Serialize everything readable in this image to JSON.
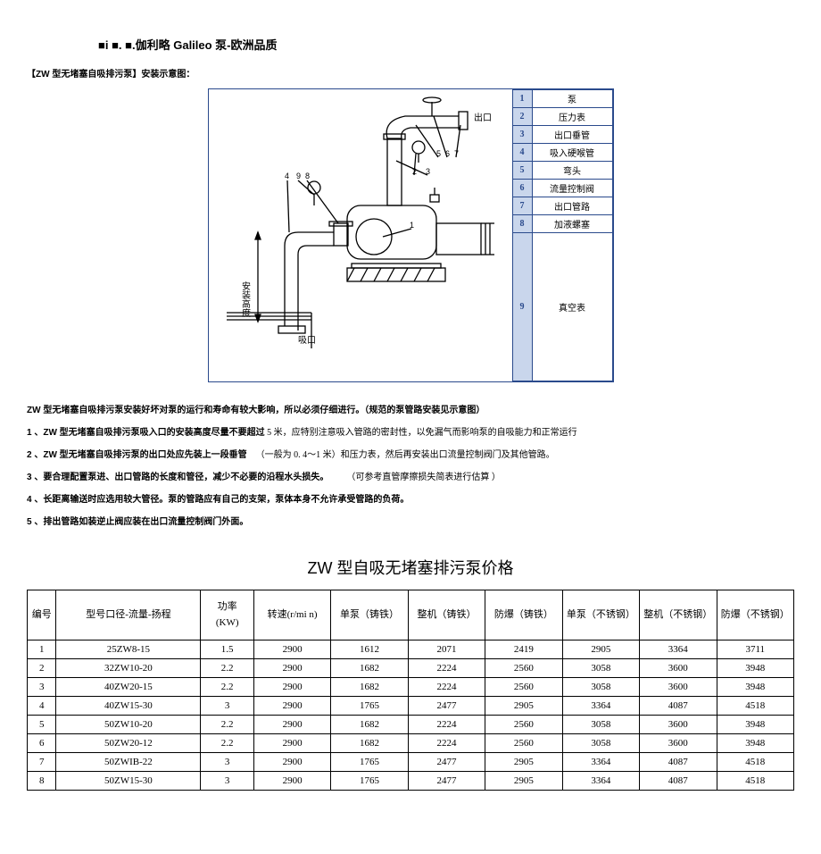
{
  "header": {
    "title": "■i ■. ■.伽利略 Galileo 泵-欧洲品质",
    "subtitle": "【ZW 型无堵塞自吸排污泵】安装示意图："
  },
  "legend": {
    "items": [
      {
        "no": "1",
        "name": "泵"
      },
      {
        "no": "2",
        "name": "压力表"
      },
      {
        "no": "3",
        "name": "出口垂管"
      },
      {
        "no": "4",
        "name": "吸入硬喉管"
      },
      {
        "no": "5",
        "name": "弯头"
      },
      {
        "no": "6",
        "name": "流量控制阀"
      },
      {
        "no": "7",
        "name": "出口管路"
      },
      {
        "no": "8",
        "name": "加液螺塞"
      }
    ],
    "tall": {
      "no": "9",
      "name": "真空表"
    }
  },
  "diagram_labels": {
    "outlet": "出口",
    "install_height": "安装高度",
    "inlet": "吸口"
  },
  "notes": {
    "l0a": "ZW 型无堵塞自吸排污泵安装好坏对泵的运行和寿命有较大影响，所以必须仔细进行。（规范的泵管路安装见示意图）",
    "l1a": "1  、ZW 型无堵塞自吸排污泵吸入口的安装高度尽量不要超过",
    "l1b": "    5 米，应特别注意吸入管路的密封性，以免漏气而影响泵的自吸能力和正常运行",
    "l2a": "2  、ZW 型无堵塞自吸排污泵的出口处应先装上一段垂管",
    "l2b": "（一般为 0. 4～1 米）和压力表，然后再安装出口流量控制阀门及其他管路。",
    "l3a": "3  、要合理配置泵进、出口管路的长度和管径，减少不必要的沿程水头损失。",
    "l3b": "（可参考直管摩擦损失简表进行估算 ）",
    "l4": "4  、长距离输送时应选用较大管径。泵的管路应有自己的支架，泵体本身不允许承受管路的负荷。",
    "l5": "5  、排出管路如装逆止阀应装在出口流量控制阀门外面。"
  },
  "price": {
    "title": "ZW 型自吸无堵塞排污泵价格",
    "headers": {
      "no": "编号",
      "model": "型号口径-流量-扬程",
      "power": "功率\n(KW)",
      "rpm": "转速(r/mi n)",
      "p1": "单泵（铸铁）",
      "p2": "整机（铸铁）",
      "p3": "防爆（铸铁）",
      "p4": "单泵（不锈钢）",
      "p5": "整机（不锈钢）",
      "p6": "防爆（不锈钢）"
    },
    "rows": [
      {
        "no": "1",
        "model": "25ZW8-15",
        "power": "1.5",
        "rpm": "2900",
        "p1": "1612",
        "p2": "2071",
        "p3": "2419",
        "p4": "2905",
        "p5": "3364",
        "p6": "3711"
      },
      {
        "no": "2",
        "model": "32ZW10-20",
        "power": "2.2",
        "rpm": "2900",
        "p1": "1682",
        "p2": "2224",
        "p3": "2560",
        "p4": "3058",
        "p5": "3600",
        "p6": "3948"
      },
      {
        "no": "3",
        "model": "40ZW20-15",
        "power": "2.2",
        "rpm": "2900",
        "p1": "1682",
        "p2": "2224",
        "p3": "2560",
        "p4": "3058",
        "p5": "3600",
        "p6": "3948"
      },
      {
        "no": "4",
        "model": "40ZW15-30",
        "power": "3",
        "rpm": "2900",
        "p1": "1765",
        "p2": "2477",
        "p3": "2905",
        "p4": "3364",
        "p5": "4087",
        "p6": "4518"
      },
      {
        "no": "5",
        "model": "50ZW10-20",
        "power": "2.2",
        "rpm": "2900",
        "p1": "1682",
        "p2": "2224",
        "p3": "2560",
        "p4": "3058",
        "p5": "3600",
        "p6": "3948"
      },
      {
        "no": "6",
        "model": "50ZW20-12",
        "power": "2.2",
        "rpm": "2900",
        "p1": "1682",
        "p2": "2224",
        "p3": "2560",
        "p4": "3058",
        "p5": "3600",
        "p6": "3948"
      },
      {
        "no": "7",
        "model": "50ZWIB-22",
        "power": "3",
        "rpm": "2900",
        "p1": "1765",
        "p2": "2477",
        "p3": "2905",
        "p4": "3364",
        "p5": "4087",
        "p6": "4518"
      },
      {
        "no": "8",
        "model": "50ZW15-30",
        "power": "3",
        "rpm": "2900",
        "p1": "1765",
        "p2": "2477",
        "p3": "2905",
        "p4": "3364",
        "p5": "4087",
        "p6": "4518"
      }
    ]
  }
}
